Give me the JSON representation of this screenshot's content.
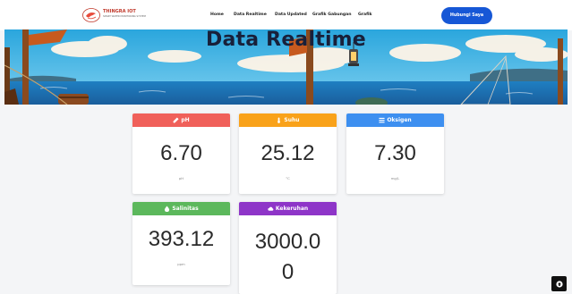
{
  "navbar": {
    "brand": "THINGRA IOT",
    "brand_sub": "SMART WATER MONITORING SYSTEM",
    "links": [
      "Home",
      "Data Realtime",
      "Data Updated",
      "Grafik Gabungan",
      "Grafik"
    ],
    "contact": "Hubungi Saya"
  },
  "hero": {
    "title": "Data Realtime"
  },
  "cards": [
    {
      "label": "pH",
      "value": "6.70",
      "unit": "pH",
      "color": "#f0605a",
      "icon": "flask-icon"
    },
    {
      "label": "Suhu",
      "value": "25.12",
      "unit": "°C",
      "color": "#f9a21a",
      "icon": "thermometer-icon"
    },
    {
      "label": "Oksigen",
      "value": "7.30",
      "unit": "mg/L",
      "color": "#3d8ff0",
      "icon": "bars-icon"
    },
    {
      "label": "Salinitas",
      "value": "393.12",
      "unit": "ppm",
      "color": "#5cb85c",
      "icon": "drop-icon"
    },
    {
      "label": "Kekeruhan",
      "value": "3000.00",
      "unit": "",
      "color": "#8e35c8",
      "icon": "cloud-icon"
    }
  ],
  "colors": {
    "primary": "#1657d6",
    "page_bg": "#f4f5f7"
  }
}
